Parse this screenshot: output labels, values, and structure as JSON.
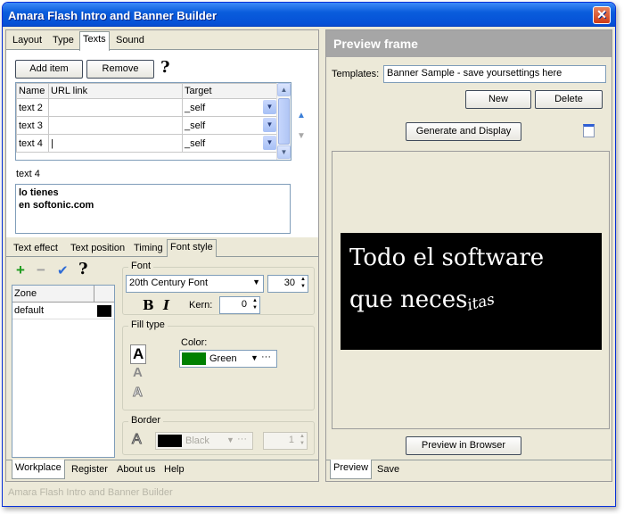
{
  "window": {
    "title": "Amara Flash Intro and Banner Builder",
    "close_glyph": "✕",
    "status_text": "Amara Flash Intro and Banner Builder"
  },
  "top_tabs": [
    {
      "label": "Layout"
    },
    {
      "label": "Type"
    },
    {
      "label": "Texts"
    },
    {
      "label": "Sound"
    }
  ],
  "texts_panel": {
    "add_item": "Add item",
    "remove": "Remove",
    "help": "?",
    "columns": {
      "name": "Name",
      "url": "URL link",
      "target": "Target"
    },
    "rows": [
      {
        "name": "text 2",
        "url": "",
        "target": "_self"
      },
      {
        "name": "text 3",
        "url": "",
        "target": "_self"
      },
      {
        "name": "text 4",
        "url": "|",
        "target": "_self"
      }
    ],
    "selected_label": "text 4",
    "text_line1": "lo tienes",
    "text_line2": "en softonic.com"
  },
  "sub_tabs": [
    {
      "label": "Text effect"
    },
    {
      "label": "Text position"
    },
    {
      "label": "Timing"
    },
    {
      "label": "Font style"
    }
  ],
  "zone_panel": {
    "add_icon": "+",
    "remove_icon": "−",
    "check_icon": "✔",
    "help": "?",
    "zone_header": "Zone",
    "zones": [
      {
        "name": "default",
        "color": "#000000"
      }
    ]
  },
  "font": {
    "legend": "Font",
    "family": "20th Century Font",
    "size": "30",
    "bold": "B",
    "italic": "I",
    "kern_label": "Kern:",
    "kern_value": "0"
  },
  "fill": {
    "legend": "Fill type",
    "glyph_a": "A",
    "color_label": "Color:",
    "color_name": "Green",
    "color_hex": "#008000",
    "more": "···"
  },
  "border": {
    "legend": "Border",
    "glyph_a": "A",
    "color_name": "Black",
    "more": "···",
    "value": "1"
  },
  "bottom_tabs": [
    {
      "label": "Workplace"
    },
    {
      "label": "Register"
    },
    {
      "label": "About us"
    },
    {
      "label": "Help"
    }
  ],
  "preview": {
    "header": "Preview frame",
    "templates_label": "Templates:",
    "templates_value": "Banner Sample - save yoursettings here",
    "new_label": "New",
    "delete_label": "Delete",
    "generate_label": "Generate and Display",
    "banner_line1": "Todo el software",
    "banner_line2": "que neces",
    "banner_tail": "itas",
    "browser_label": "Preview in Browser"
  },
  "right_tabs": [
    {
      "label": "Preview"
    },
    {
      "label": "Save"
    }
  ]
}
